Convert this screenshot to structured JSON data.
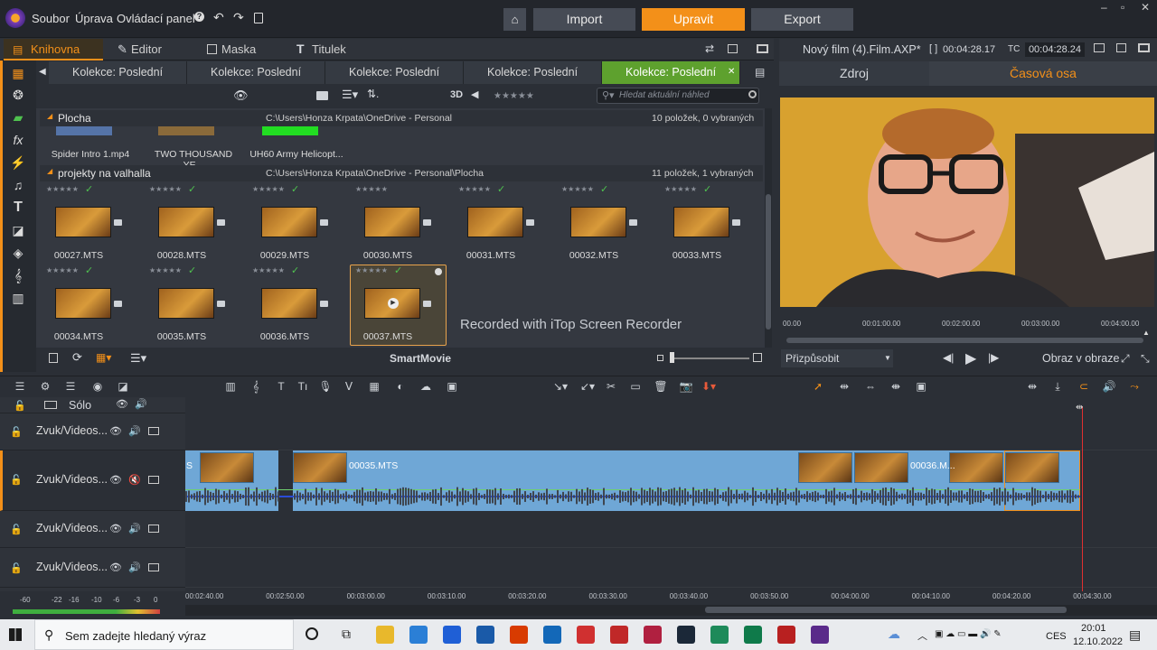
{
  "menu": {
    "file": "Soubor",
    "edit": "Úprava",
    "control_panel": "Ovládací panel"
  },
  "top_buttons": {
    "import": "Import",
    "edit": "Upravit",
    "export": "Export"
  },
  "library_tabs": {
    "library": "Knihovna",
    "editor": "Editor",
    "mask": "Maska",
    "title": "Titulek"
  },
  "collection_tabs": [
    "Kolekce: Poslední imp...",
    "Kolekce: Poslední imp...",
    "Kolekce: Poslední imp...",
    "Kolekce: Poslední imp...",
    "Kolekce: Poslední imp..."
  ],
  "toolbar": {
    "three_d": "3D",
    "search_placeholder": "Hledat aktuální náhled"
  },
  "groups": [
    {
      "name": "Plocha",
      "path": "C:\\Users\\Honza Krpata\\OneDrive - Personal",
      "count": "10 položek, 0 vybraných",
      "files": [
        "Spider Intro 1.mp4",
        "TWO THOUSAND YE...",
        "UH60 Army Helicopt..."
      ]
    },
    {
      "name": "projekty na valhalla",
      "path": "C:\\Users\\Honza Krpata\\OneDrive - Personal\\Plocha",
      "count": "11 položek, 1 vybraných",
      "files": [
        "00027.MTS",
        "00028.MTS",
        "00029.MTS",
        "00030.MTS",
        "00031.MTS",
        "00032.MTS",
        "00033.MTS",
        "00034.MTS",
        "00035.MTS",
        "00036.MTS",
        "00037.MTS"
      ]
    }
  ],
  "watermark": "Recorded with iTop Screen Recorder",
  "smartmovie": "SmartMovie",
  "player": {
    "project_name": "Nový film (4).Film.AXP*",
    "in_point": "00:04:28.17",
    "tc_label": "TC",
    "timecode": "00:04:28.24",
    "source_tab": "Zdroj",
    "timeline_tab": "Časová osa",
    "ruler": [
      "00.00",
      "00:01:00.00",
      "00:02:00.00",
      "00:03:00.00",
      "00:04:00.00"
    ],
    "fit": "Přizpůsobit",
    "pip": "Obraz v obraze"
  },
  "timeline": {
    "solo": "Sólo",
    "tracks": [
      "Zvuk/Videos...",
      "Zvuk/Videos...",
      "Zvuk/Videos...",
      "Zvuk/Videos..."
    ],
    "clip_labels": [
      "S",
      "00035.MTS",
      "00036.M..."
    ],
    "ruler": [
      "00:02:40.00",
      "00:02:50.00",
      "00:03:00.00",
      "00:03:10.00",
      "00:03:20.00",
      "00:03:30.00",
      "00:03:40.00",
      "00:03:50.00",
      "00:04:00.00",
      "00:04:10.00",
      "00:04:20.00",
      "00:04:30.00"
    ],
    "meter": [
      "-60",
      "-22",
      "-16",
      "-10",
      "-6",
      "-3",
      "0"
    ]
  },
  "taskbar": {
    "search": "Sem zadejte hledaný výraz",
    "lang": "CES",
    "time": "20:01",
    "date": "12.10.2022"
  },
  "colors": {
    "accent": "#f39019",
    "active_tab": "#5ea12e",
    "clip": "#6fa7d6",
    "playhead": "#e03030"
  }
}
